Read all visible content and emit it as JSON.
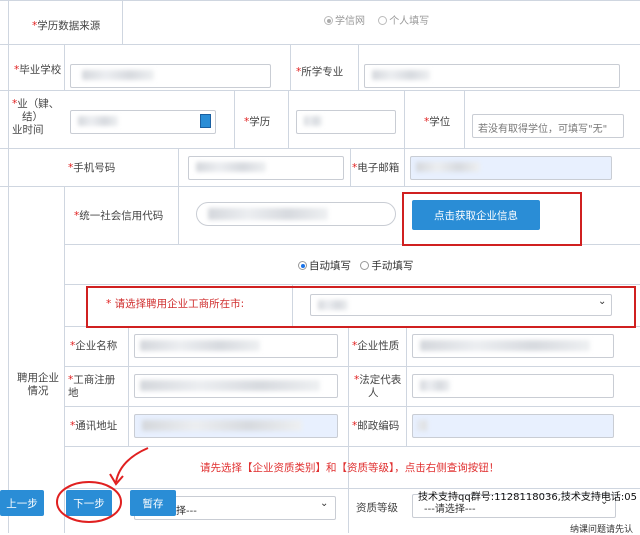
{
  "form": {
    "source": {
      "label": "学历数据来源",
      "opt1": "学信网",
      "opt2": "个人填写"
    },
    "school": {
      "label": "毕业学校"
    },
    "major": {
      "label": "所学专业"
    },
    "time": {
      "line1": "业（肄、",
      "line2": "结）",
      "line3": "业时间"
    },
    "edu": {
      "label": "学历"
    },
    "degree": {
      "label": "学位",
      "placeholder": "若没有取得学位，可填写\"无\""
    },
    "phone": {
      "label": "手机号码"
    },
    "email": {
      "label": "电子邮箱"
    },
    "credit": {
      "label": "统一社会信用代码"
    },
    "fetch_button": "点击获取企业信息",
    "fill_mode": {
      "auto": "自动填写",
      "manual": "手动填写"
    },
    "city": {
      "label": "请选择聘用企业工商所在市:"
    },
    "company_section": {
      "line1": "聘用企业",
      "line2": "情况"
    },
    "company_name": {
      "label": "企业名称"
    },
    "company_type": {
      "label": "企业性质"
    },
    "reg_place": {
      "line1": "工商注册",
      "line2": "地"
    },
    "legal_rep": {
      "line1": "法定代表",
      "line2": "人"
    },
    "address": {
      "label": "通讯地址"
    },
    "zipcode": {
      "label": "邮政编码"
    },
    "notice": "请先选择【企业资质类别】和【资质等级】，点击右侧查询按钮！",
    "qual_type_select": "择---",
    "qual_level": {
      "label": "资质等级",
      "select": "---请选择---"
    }
  },
  "footer": {
    "prev": "上一步",
    "next": "下一步",
    "save": "暂存",
    "support": "技术支持qq群号:1128118036,技术支持电话:05",
    "support2": "纳课问题请先认"
  }
}
